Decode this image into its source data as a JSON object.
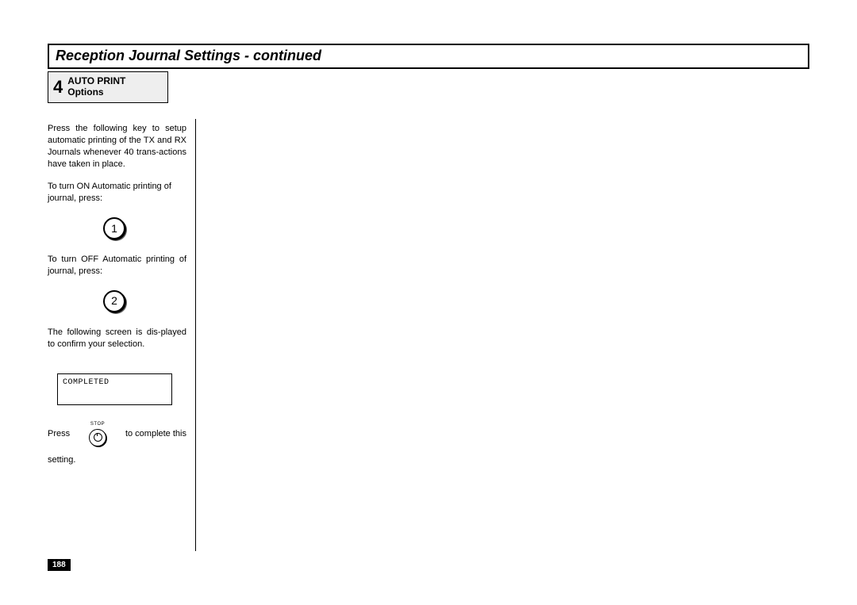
{
  "title": "Reception Journal Settings - continued",
  "step": {
    "num": "4",
    "line1": "AUTO PRINT",
    "line2": "Options"
  },
  "para1": "Press the following key to setup automatic printing of the TX and RX Journals whenever 40 trans-actions have taken in place.",
  "para2": "To turn ON Automatic printing of journal, press:",
  "key1": "1",
  "para3": "To turn OFF Automatic printing of journal, press:",
  "key2": "2",
  "para4": "The following screen is dis-played to confirm your selection.",
  "display": "COMPLETED",
  "pressWord": "Press",
  "stopLabel": "STOP",
  "pressTail": "to complete this",
  "settingLine": "setting.",
  "pageNum": "188"
}
